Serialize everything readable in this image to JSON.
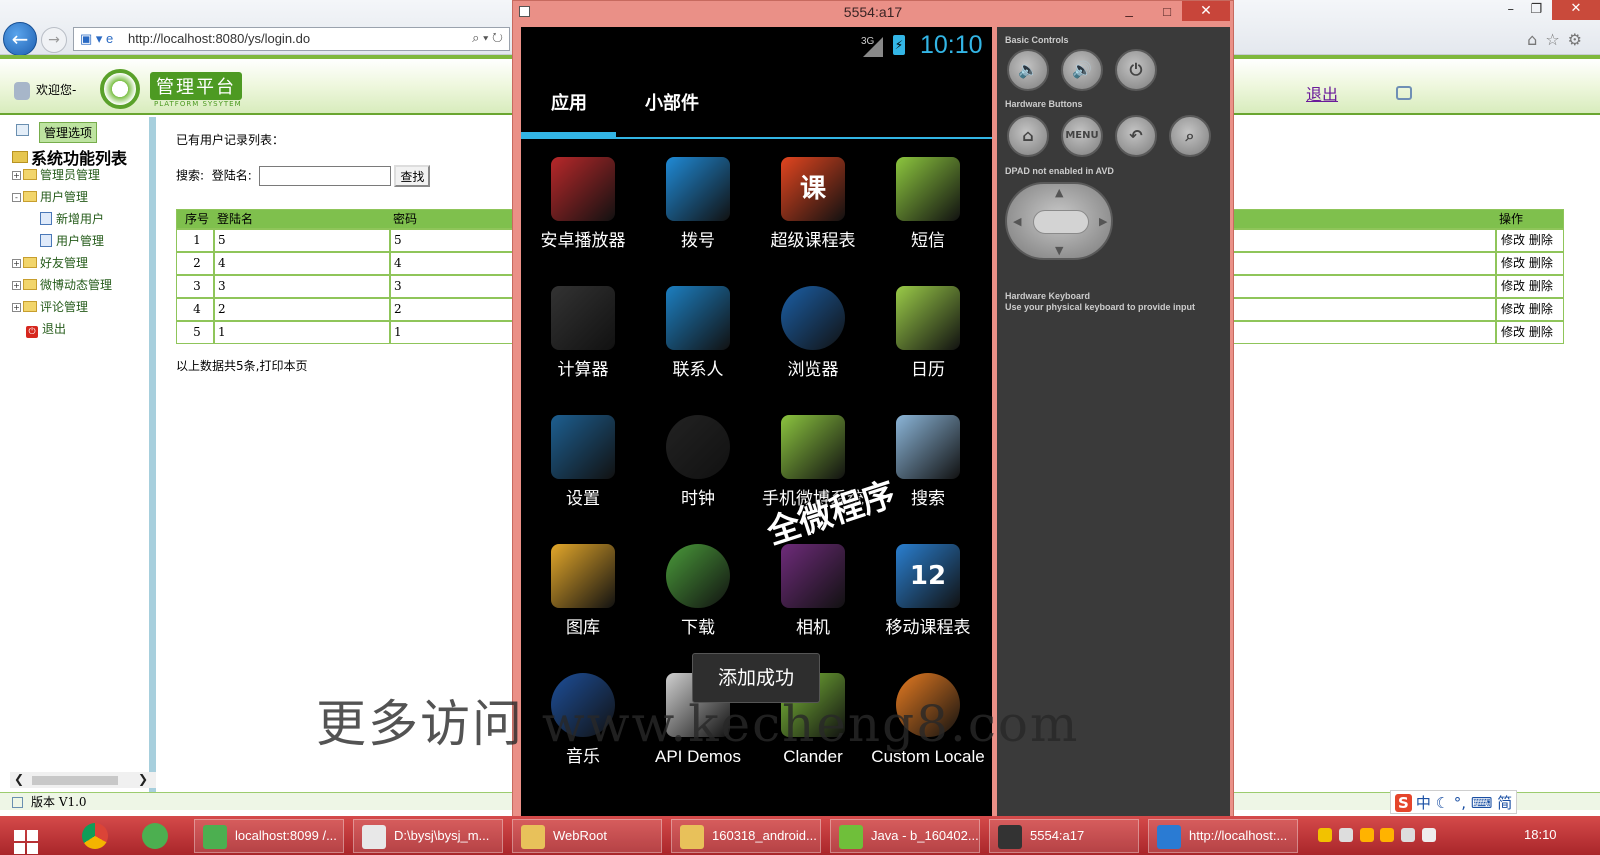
{
  "browser": {
    "url": "http://localhost:8080/ys/login.do"
  },
  "webapp": {
    "welcome": "欢迎您-",
    "logo_title": "管理平台",
    "logo_sub": "PLATFORM SYSYTEM",
    "logout_top": "退出",
    "sidebar": {
      "header": "管理选项",
      "title": "系统功能列表",
      "items": [
        {
          "label": "管理员管理",
          "type": "folder",
          "expand": "+"
        },
        {
          "label": "用户管理",
          "type": "folder",
          "expand": "-"
        },
        {
          "label": "新增用户",
          "type": "child"
        },
        {
          "label": "用户管理",
          "type": "child"
        },
        {
          "label": "好友管理",
          "type": "folder",
          "expand": "+"
        },
        {
          "label": "微博动态管理",
          "type": "folder",
          "expand": "+"
        },
        {
          "label": "评论管理",
          "type": "folder",
          "expand": "+"
        },
        {
          "label": "退出",
          "type": "exit"
        }
      ]
    },
    "main": {
      "list_title": "已有用户记录列表：",
      "search_label": "搜索:",
      "login_label": "登陆名:",
      "search_value": "",
      "search_button": "查找",
      "columns": [
        "序号",
        "登陆名",
        "密码",
        "操作"
      ],
      "rows": [
        [
          "1",
          "5",
          "5"
        ],
        [
          "2",
          "4",
          "4"
        ],
        [
          "3",
          "3",
          "3"
        ],
        [
          "4",
          "2",
          "2"
        ],
        [
          "5",
          "1",
          "1"
        ]
      ],
      "edit_label": "修改",
      "delete_label": "删除",
      "summary": "以上数据共5条,打印本页"
    },
    "footer": "版本 V1.0"
  },
  "emulator": {
    "title": "5554:a17",
    "status": {
      "network": "3G",
      "time": "10:10"
    },
    "tabs": [
      "应用",
      "小部件"
    ],
    "apps": [
      {
        "label": "安卓播放器",
        "icon": "music-player-icon",
        "color": "#b8282a"
      },
      {
        "label": "拨号",
        "icon": "phone-icon",
        "color": "#1f8ad6"
      },
      {
        "label": "超级课程表",
        "icon": "course-table-icon",
        "color": "#e2451f",
        "glyph": "课"
      },
      {
        "label": "短信",
        "icon": "sms-icon",
        "color": "#8cc63e"
      },
      {
        "label": "计算器",
        "icon": "calculator-icon",
        "color": "#333333"
      },
      {
        "label": "联系人",
        "icon": "contacts-icon",
        "color": "#1c7fc1"
      },
      {
        "label": "浏览器",
        "icon": "browser-globe-icon",
        "color": "#1b5fa6"
      },
      {
        "label": "日历",
        "icon": "calendar-icon",
        "color": "#9acb48"
      },
      {
        "label": "设置",
        "icon": "settings-icon",
        "color": "#1d5f91"
      },
      {
        "label": "时钟",
        "icon": "clock-icon",
        "color": "#222222"
      },
      {
        "label": "手机微博系统",
        "icon": "android-robot-icon",
        "color": "#8bc43f"
      },
      {
        "label": "搜索",
        "icon": "search-magnifier-icon",
        "color": "#8bb5d8"
      },
      {
        "label": "图库",
        "icon": "gallery-icon",
        "color": "#e3a72a"
      },
      {
        "label": "下载",
        "icon": "download-icon",
        "color": "#4a9b3a"
      },
      {
        "label": "相机",
        "icon": "camera-icon",
        "color": "#6e2b7a"
      },
      {
        "label": "移动课程表",
        "icon": "mobile-schedule-icon",
        "color": "#2a7fd0",
        "glyph": "12"
      },
      {
        "label": "音乐",
        "icon": "music-speaker-icon",
        "color": "#1d4f9a"
      },
      {
        "label": "API Demos",
        "icon": "api-demos-folder-icon",
        "color": "#cfcfcf"
      },
      {
        "label": "Clander",
        "icon": "android-robot-icon",
        "color": "#7fbf3a"
      },
      {
        "label": "Custom Locale",
        "icon": "custom-locale-icon",
        "color": "#e67b21"
      }
    ],
    "toast": "添加成功",
    "panel": {
      "basic_controls": "Basic Controls",
      "hardware_buttons": "Hardware Buttons",
      "dpad_note": "DPAD not enabled in AVD",
      "keyboard_title": "Hardware Keyboard",
      "keyboard_note": "Use your physical keyboard to provide input",
      "menu_label": "MENU"
    }
  },
  "watermarks": {
    "stamp": "全微程序",
    "line": "更多访问 www.kecheng8.com"
  },
  "taskbar": {
    "items": [
      {
        "label": "localhost:8099 /...",
        "color": "#4caf50"
      },
      {
        "label": "D:\\bysj\\bysj_m...",
        "color": "#e8e8e8"
      },
      {
        "label": "WebRoot",
        "color": "#e8c15a"
      },
      {
        "label": "160318_android...",
        "color": "#e8c15a"
      },
      {
        "label": "Java - b_160402...",
        "color": "#6fbf3a"
      },
      {
        "label": "5554:a17",
        "color": "#333333"
      },
      {
        "label": "http://localhost:...",
        "color": "#2a7bd3"
      }
    ],
    "ime": [
      "中",
      "简"
    ],
    "time": "18:10"
  }
}
